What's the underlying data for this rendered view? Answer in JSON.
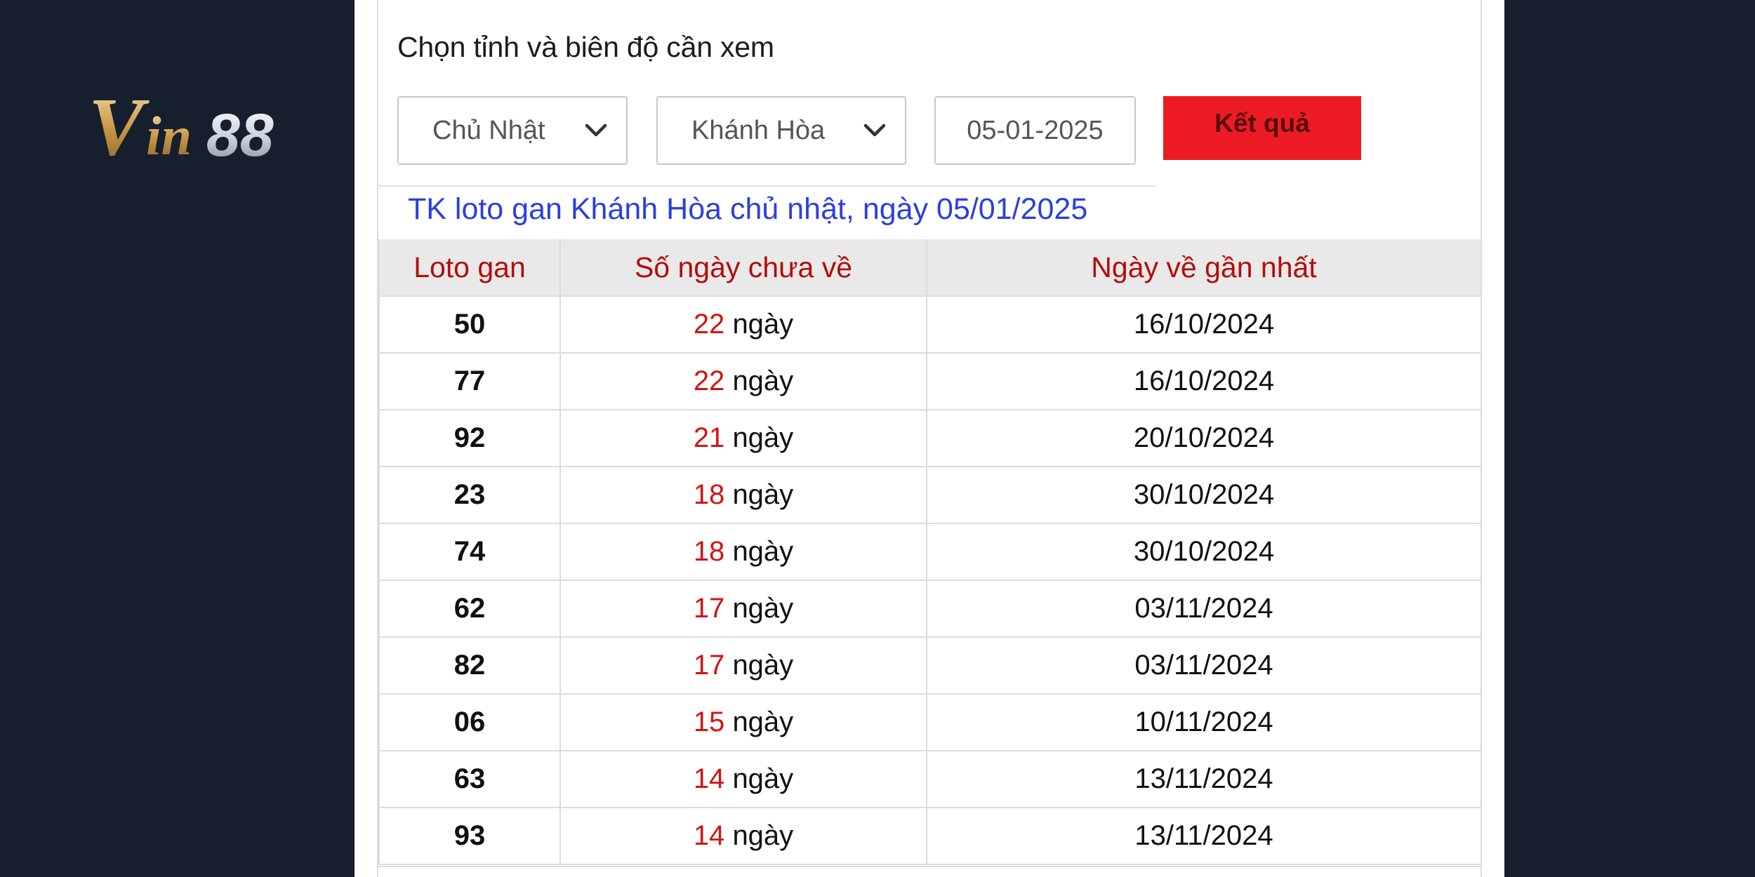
{
  "brand": {
    "logo_text": "Vin88",
    "gold": "#d9b56a",
    "silver": "#d8dde3"
  },
  "filter": {
    "heading": "Chọn tỉnh và biên độ cần xem",
    "day_select": "Chủ Nhật",
    "province_select": "Khánh Hòa",
    "date_value": "05-01-2025",
    "submit_label": "Kết quả"
  },
  "caption": "TK loto gan Khánh Hòa chủ nhật, ngày 05/01/2025",
  "table": {
    "headers": [
      "Loto gan",
      "Số ngày chưa về",
      "Ngày về gần nhất"
    ],
    "unit": "ngày",
    "rows": [
      {
        "loto": "50",
        "days": "22",
        "last": "16/10/2024"
      },
      {
        "loto": "77",
        "days": "22",
        "last": "16/10/2024"
      },
      {
        "loto": "92",
        "days": "21",
        "last": "20/10/2024"
      },
      {
        "loto": "23",
        "days": "18",
        "last": "30/10/2024"
      },
      {
        "loto": "74",
        "days": "18",
        "last": "30/10/2024"
      },
      {
        "loto": "62",
        "days": "17",
        "last": "03/11/2024"
      },
      {
        "loto": "82",
        "days": "17",
        "last": "03/11/2024"
      },
      {
        "loto": "06",
        "days": "15",
        "last": "10/11/2024"
      },
      {
        "loto": "63",
        "days": "14",
        "last": "13/11/2024"
      },
      {
        "loto": "93",
        "days": "14",
        "last": "13/11/2024"
      }
    ]
  },
  "colors": {
    "background": "#161f2e",
    "accent_red": "#ed1c24",
    "header_text": "#b30d0d",
    "caption_blue": "#2b3fe0"
  }
}
